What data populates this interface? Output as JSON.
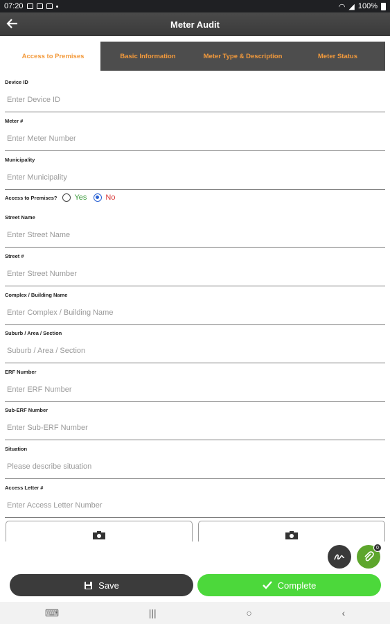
{
  "status_bar": {
    "time": "07:20",
    "battery": "100%"
  },
  "app_bar": {
    "title": "Meter Audit"
  },
  "tabs": [
    {
      "label": "Access to Premises"
    },
    {
      "label": "Basic Information"
    },
    {
      "label": "Meter Type & Description"
    },
    {
      "label": "Meter Status"
    }
  ],
  "form": {
    "device_id": {
      "label": "Device ID",
      "placeholder": "Enter Device ID"
    },
    "meter_number": {
      "label": "Meter #",
      "placeholder": "Enter Meter Number"
    },
    "municipality": {
      "label": "Municipality",
      "placeholder": "Enter Municipality"
    },
    "access": {
      "label": "Access to Premises?",
      "yes": "Yes",
      "no": "No",
      "selected": "No"
    },
    "street_name": {
      "label": "Street Name",
      "placeholder": "Enter Street Name"
    },
    "street_number": {
      "label": "Street #",
      "placeholder": "Enter Street Number"
    },
    "complex": {
      "label": "Complex / Building Name",
      "placeholder": "Enter Complex / Building Name"
    },
    "suburb": {
      "label": "Suburb / Area / Section",
      "placeholder": "Suburb / Area / Section"
    },
    "erf": {
      "label": "ERF Number",
      "placeholder": "Enter ERF Number"
    },
    "sub_erf": {
      "label": "Sub-ERF Number",
      "placeholder": "Enter Sub-ERF Number"
    },
    "situation": {
      "label": "Situation",
      "placeholder": "Please describe situation"
    },
    "access_letter": {
      "label": "Access Letter #",
      "placeholder": "Enter Access Letter Number"
    }
  },
  "fab": {
    "attachment_count": "0"
  },
  "actions": {
    "save": "Save",
    "complete": "Complete"
  },
  "icons": {
    "back": "arrow-left-icon",
    "sign": "signature-icon",
    "attach": "paperclip-icon",
    "save": "floppy-disk-icon",
    "complete": "check-icon",
    "camera": "camera-icon"
  },
  "colors": {
    "tab_accent": "#f39a3c",
    "complete": "#4cd83b",
    "appbar": "#3a3a3a"
  }
}
